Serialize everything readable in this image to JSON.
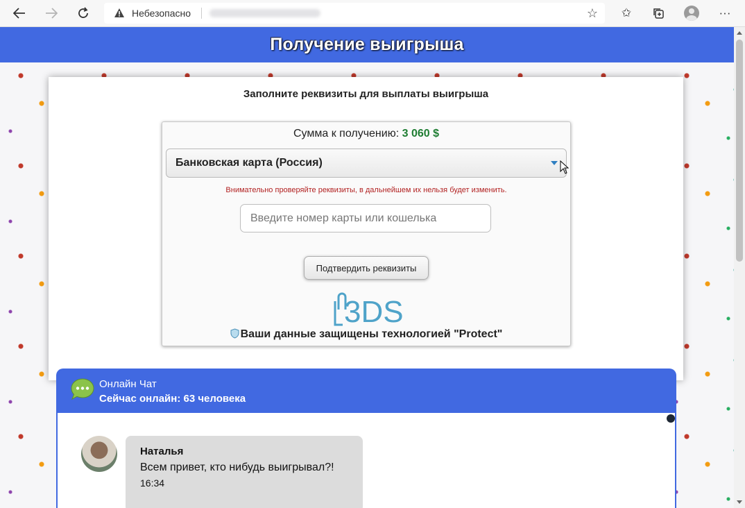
{
  "browser": {
    "security_label": "Небезопасно"
  },
  "page": {
    "header_title": "Получение выигрыша",
    "form_heading": "Заполните реквизиты для выплаты выигрыша",
    "amount_label": "Сумма к получению:",
    "amount_value": "3 060 $",
    "payment_method_selected": "Банковская карта (Россия)",
    "warning": "Внимательно проверяйте реквизиты, в дальнейшем их нельзя будет изменить.",
    "card_input_placeholder": "Введите номер карты или кошелька",
    "confirm_button": "Подтвердить реквизиты",
    "logo_text": "3DS",
    "protect_text": "Ваши данные защищены технологией \"Protect\""
  },
  "chat": {
    "title": "Онлайн Чат",
    "online_label": "Сейчас онлайн:",
    "online_count": "63 человека",
    "messages": [
      {
        "name": "Наталья",
        "text": "Всем привет, кто нибудь выигрывал?!",
        "time": "16:34"
      }
    ]
  },
  "colors": {
    "header_blue": "#4169e1",
    "amount_green": "#1e7d32",
    "warning_red": "#b22222"
  }
}
